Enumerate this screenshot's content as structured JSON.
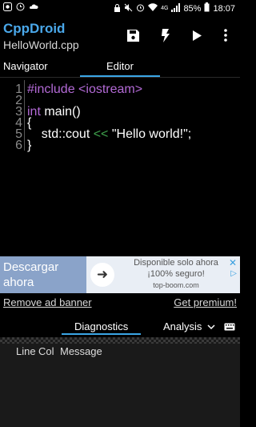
{
  "status_bar": {
    "battery": "85%",
    "time": "18:07",
    "network": "4G"
  },
  "app": {
    "title": "CppDroid",
    "file": "HelloWorld.cpp"
  },
  "toolbar_icons": [
    "save-icon",
    "flash-icon",
    "run-icon",
    "more-vert-icon"
  ],
  "tabs": [
    {
      "label": "Navigator"
    },
    {
      "label": "Editor"
    }
  ],
  "editor": {
    "lines": [
      {
        "num": "1",
        "text": "#include <iostream>"
      },
      {
        "num": "2",
        "text": ""
      },
      {
        "num": "3",
        "kw": "int",
        "rest": " main()"
      },
      {
        "num": "4",
        "text": "{"
      },
      {
        "num": "5",
        "pre": "    std::cout ",
        "op": "<<",
        "post": " \"Hello world!\";"
      },
      {
        "num": "6",
        "text": "}"
      }
    ]
  },
  "ad": {
    "left_text": "Descargar ahora",
    "right_line1": "Disponible solo ahora",
    "right_line2": "¡100% seguro!",
    "right_line3": "top-boom.com"
  },
  "links": {
    "remove_ad": "Remove ad banner",
    "premium": "Get premium!"
  },
  "bottom_tabs": [
    {
      "label": "Diagnostics"
    },
    {
      "label": "Analysis"
    }
  ],
  "diagnostics": {
    "columns": [
      "Line",
      "Col",
      "Message"
    ]
  }
}
